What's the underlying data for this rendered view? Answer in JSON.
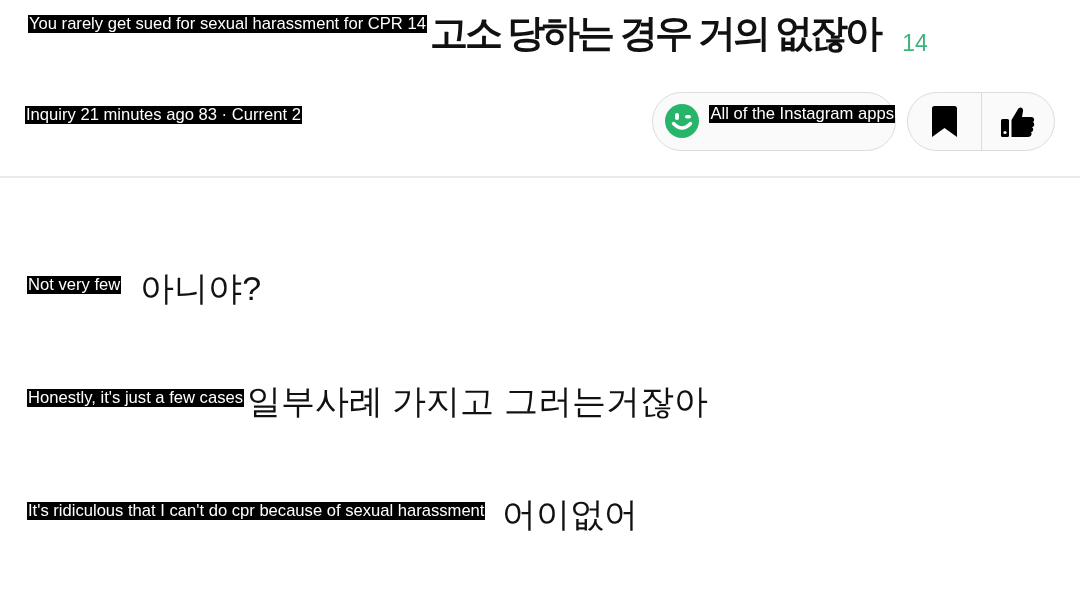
{
  "post": {
    "title": {
      "overlay_text": "You rarely get sued for sexual harassment for CPR 14",
      "text": "고소 당하는 경우 거의 없잖아"
    },
    "comment_count": "14",
    "meta": {
      "overlay_text": "Inquiry 21 minutes ago 83 · Current 2"
    },
    "smiley_button": {
      "overlay_text": "All of the Instagram apps"
    }
  },
  "body": [
    {
      "overlay_text": "Not very few",
      "text": "아니야?"
    },
    {
      "overlay_text": "Honestly, it's just a few cases",
      "text": "일부사례 가지고 그러는거잖아"
    },
    {
      "overlay_text": "It's ridiculous that I can't do cpr because of sexual harassment",
      "text": "어이없어"
    }
  ]
}
